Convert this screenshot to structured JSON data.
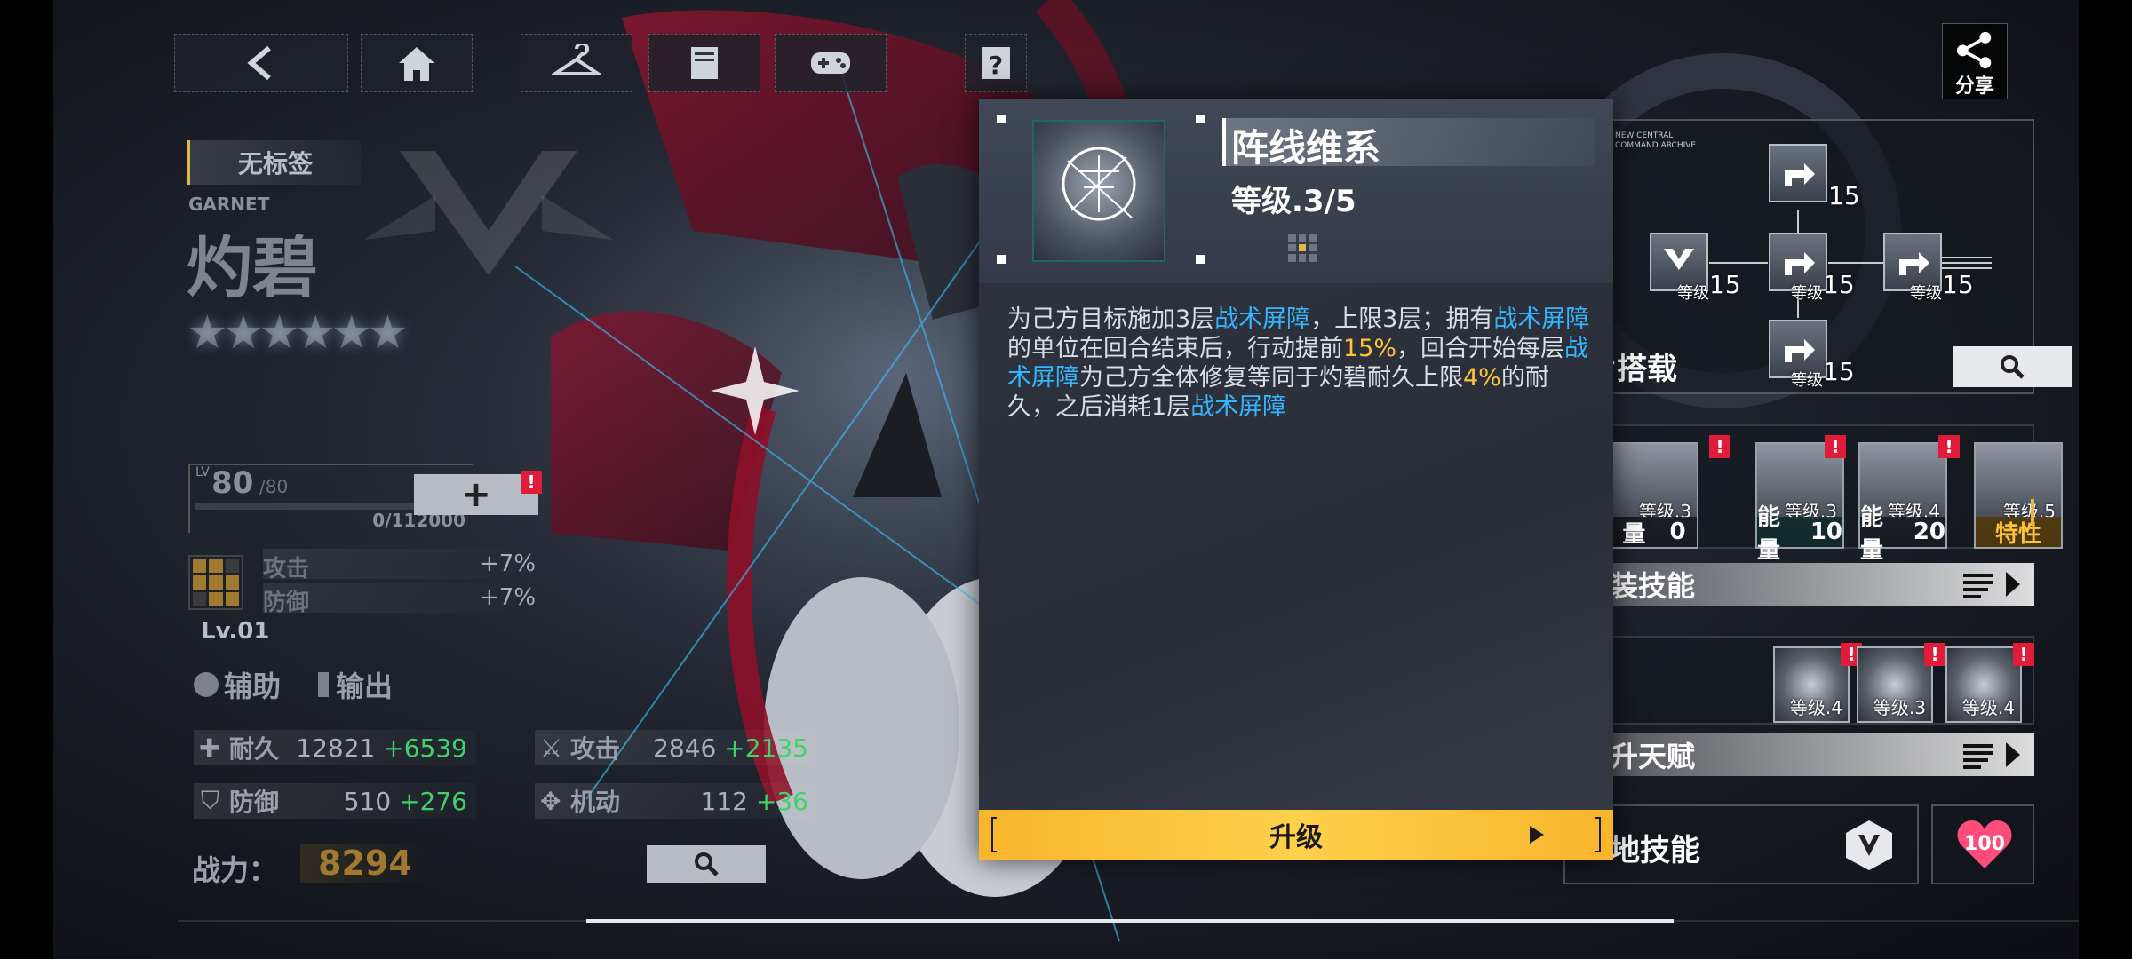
{
  "colors": {
    "accent_blue": "#33b6ff",
    "accent_yellow": "#ffc435",
    "stat_green": "#41d36a",
    "upgrade_gold": "#f7b52c",
    "alert_red": "#e01c3a"
  },
  "top_nav": {
    "buttons": [
      {
        "icon": "back-arrow-icon"
      },
      {
        "icon": "home-icon"
      },
      {
        "icon": "wardrobe-hanger-icon"
      },
      {
        "icon": "archive-book-icon"
      },
      {
        "icon": "gamepad-icon"
      },
      {
        "icon": "question-icon"
      }
    ],
    "share_label": "分享"
  },
  "character": {
    "tag": "无标签",
    "name_en": "GARNET",
    "name": "灼碧",
    "stars": "★★★★★★",
    "level": "80",
    "level_max": "/80",
    "level_prefix": "LV",
    "exp": "0/112000",
    "bonus_atk_label": "攻击",
    "bonus_atk": "+7%",
    "bonus_def_label": "防御",
    "bonus_def": "+7%",
    "module_level": "Lv.01",
    "roles": [
      "辅助",
      "输出"
    ],
    "stats": [
      {
        "label": "耐久",
        "base": "12821",
        "add": "+6539",
        "icon": "shield-cross-icon"
      },
      {
        "label": "攻击",
        "base": "2846",
        "add": "+2135",
        "icon": "crossed-swords-icon"
      },
      {
        "label": "防御",
        "base": "510",
        "add": "+276",
        "icon": "shield-icon"
      },
      {
        "label": "机动",
        "base": "112",
        "add": "+36",
        "icon": "move-arrows-icon"
      }
    ],
    "power_label": "战力：",
    "power_value": "8294"
  },
  "skill_popup": {
    "title": "阵线维系",
    "level_text": "等级.3/5",
    "desc": [
      {
        "t": "为己方目标施加3层",
        "c": "n"
      },
      {
        "t": "战术屏障",
        "c": "k"
      },
      {
        "t": "，上限3层；拥有",
        "c": "n"
      },
      {
        "t": "战术屏障",
        "c": "k"
      },
      {
        "t": "的单位在回合结束后，行动提前",
        "c": "n"
      },
      {
        "t": "15%",
        "c": "v"
      },
      {
        "t": "，回合开始每层",
        "c": "n"
      },
      {
        "t": "战术屏障",
        "c": "k"
      },
      {
        "t": "为己方全体修复等同于灼碧耐久上限",
        "c": "n"
      },
      {
        "t": "4%",
        "c": "v"
      },
      {
        "t": "的耐久，之后消耗1层",
        "c": "n"
      },
      {
        "t": "战术屏障",
        "c": "k"
      }
    ],
    "upgrade_label": "升级"
  },
  "right_panel": {
    "chip_header": "NEW CENTRAL COMMAND ARCHIVE",
    "chip_section_label": "片搭载",
    "chip_level_label": "等级",
    "chips": [
      {
        "level": "15"
      },
      {
        "level": "15"
      },
      {
        "level": "15"
      },
      {
        "level": "15"
      },
      {
        "level": "15"
      }
    ],
    "skills": [
      {
        "level": "等级.3",
        "cap_label": "量",
        "cap_value": "0"
      },
      {
        "level": "等级.3",
        "cap_label": "能量",
        "cap_value": "10"
      },
      {
        "level": "等级.4",
        "cap_label": "能量",
        "cap_value": "20"
      },
      {
        "level": "等级.5",
        "cap_label": "特性",
        "cap_value": ""
      }
    ],
    "equip_skill_label": "装技能",
    "talents": [
      {
        "level": "等级.4"
      },
      {
        "level": "等级.3"
      },
      {
        "level": "等级.4"
      }
    ],
    "talent_label": "升天赋",
    "base_skill_label": "地技能",
    "heart_value": "100",
    "alert_mark": "!"
  }
}
